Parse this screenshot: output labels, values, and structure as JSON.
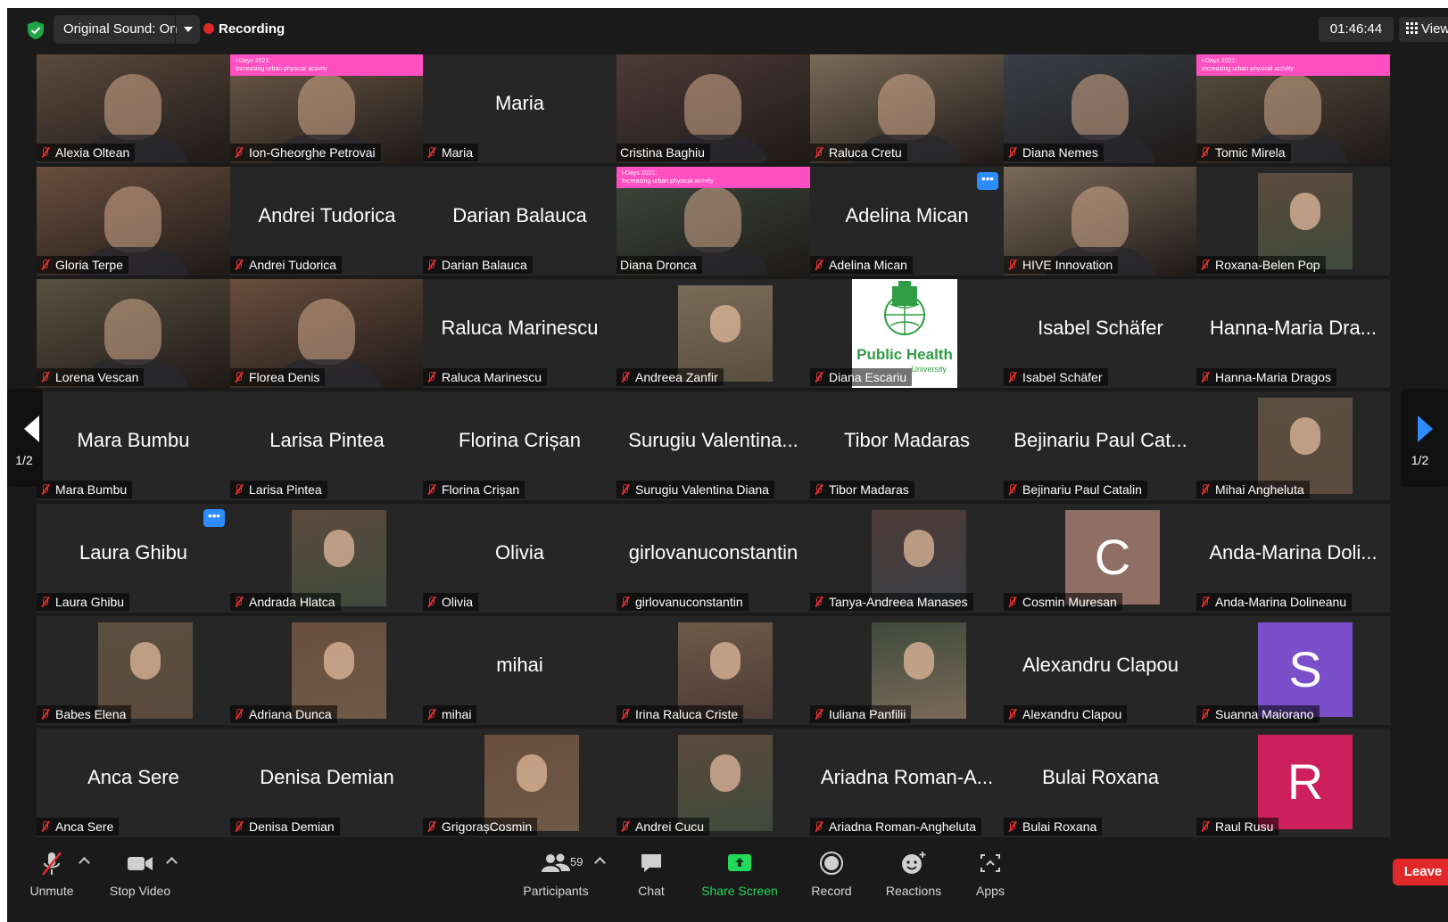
{
  "topbar": {
    "original_sound": "Original Sound: On",
    "recording": "Recording",
    "timer": "01:46:44",
    "view": "View"
  },
  "banner_text": [
    "i-Days 2021:",
    "Increasing urban physical activity"
  ],
  "pagination": {
    "left": "1/2",
    "right": "1/2"
  },
  "tiles": [
    {
      "name": "Alexia Oltean",
      "kind": "video"
    },
    {
      "name": "Ion-Gheorghe Petrovai",
      "kind": "video-banner"
    },
    {
      "name": "Maria",
      "display": "Maria",
      "kind": "name"
    },
    {
      "name": "Cristina Baghiu",
      "kind": "video",
      "active": true,
      "muted": false
    },
    {
      "name": "Raluca Cretu",
      "kind": "video"
    },
    {
      "name": "Diana Nemes",
      "kind": "video"
    },
    {
      "name": "Tomic Mirela",
      "kind": "video-banner"
    },
    {
      "name": "Gloria Terpe",
      "kind": "video"
    },
    {
      "name": "Andrei Tudorica",
      "display": "Andrei Tudorica",
      "kind": "name"
    },
    {
      "name": "Darian Balauca",
      "display": "Darian Balauca",
      "kind": "name"
    },
    {
      "name": "Diana Dronca",
      "kind": "video-banner",
      "muted": false
    },
    {
      "name": "Adelina Mican",
      "display": "Adelina Mican",
      "kind": "name",
      "more": true
    },
    {
      "name": "HIVE Innovation",
      "kind": "video"
    },
    {
      "name": "Roxana-Belen Pop",
      "kind": "photo"
    },
    {
      "name": "Lorena Vescan",
      "kind": "video"
    },
    {
      "name": "Florea Denis",
      "kind": "video"
    },
    {
      "name": "Raluca Marinescu",
      "display": "Raluca Marinescu",
      "kind": "name"
    },
    {
      "name": "Andreea Zanfir",
      "kind": "photo"
    },
    {
      "name": "Diana Escariu",
      "kind": "logo",
      "logo_text": "Public Health",
      "logo_sub": "University"
    },
    {
      "name": "Isabel Schäfer",
      "display": "Isabel Schäfer",
      "kind": "name"
    },
    {
      "name": "Hanna-Maria Dragos",
      "display": "Hanna-Maria Dra...",
      "kind": "name"
    },
    {
      "name": "Mara Bumbu",
      "display": "Mara Bumbu",
      "kind": "name"
    },
    {
      "name": "Larisa Pintea",
      "display": "Larisa Pintea",
      "kind": "name"
    },
    {
      "name": "Florina Crișan",
      "display": "Florina Crișan",
      "kind": "name"
    },
    {
      "name": "Surugiu Valentina Diana",
      "display": "Surugiu Valentina...",
      "kind": "name"
    },
    {
      "name": "Tibor Madaras",
      "display": "Tibor Madaras",
      "kind": "name"
    },
    {
      "name": "Bejinariu Paul Catalin",
      "display": "Bejinariu Paul Cat...",
      "kind": "name"
    },
    {
      "name": "Mihai Angheluta",
      "kind": "photo"
    },
    {
      "name": "Laura Ghibu",
      "display": "Laura Ghibu",
      "kind": "name",
      "more": true
    },
    {
      "name": "Andrada Hlatca",
      "kind": "photo"
    },
    {
      "name": "Olivia",
      "display": "Olivia",
      "kind": "name"
    },
    {
      "name": "girlovanuconstantin",
      "display": "girlovanuconstantin",
      "kind": "name"
    },
    {
      "name": "Tanya-Andreea Manases",
      "kind": "photo"
    },
    {
      "name": "Cosmin Muresan",
      "kind": "avatar",
      "letter": "C",
      "color": "#8f6e63"
    },
    {
      "name": "Anda-Marina Dolineanu",
      "display": "Anda-Marina Doli...",
      "kind": "name"
    },
    {
      "name": "Babes Elena",
      "kind": "photo"
    },
    {
      "name": "Adriana Dunca",
      "kind": "photo"
    },
    {
      "name": "mihai",
      "display": "mihai",
      "kind": "name"
    },
    {
      "name": "Irina Raluca Criste",
      "kind": "photo"
    },
    {
      "name": "Iuliana Panfilii",
      "kind": "photo"
    },
    {
      "name": "Alexandru Clapou",
      "display": "Alexandru Clapou",
      "kind": "name"
    },
    {
      "name": "Suanna Maiorano",
      "kind": "avatar",
      "letter": "S",
      "color": "#7b4fc9"
    },
    {
      "name": "Anca Sere",
      "display": "Anca Sere",
      "kind": "name"
    },
    {
      "name": "Denisa Demian",
      "display": "Denisa Demian",
      "kind": "name"
    },
    {
      "name": "GrigorașCosmin",
      "kind": "photo"
    },
    {
      "name": "Andrei Cucu",
      "kind": "photo"
    },
    {
      "name": "Ariadna Roman-Angheluta",
      "display": "Ariadna Roman-A...",
      "kind": "name"
    },
    {
      "name": "Bulai Roxana",
      "display": "Bulai Roxana",
      "kind": "name"
    },
    {
      "name": "Raul Rusu",
      "kind": "avatar",
      "letter": "R",
      "color": "#cc1f5c"
    }
  ],
  "toolbar": {
    "unmute": "Unmute",
    "stop_video": "Stop Video",
    "participants": "Participants",
    "participants_count": "59",
    "chat": "Chat",
    "share_screen": "Share Screen",
    "record": "Record",
    "reactions": "Reactions",
    "apps": "Apps",
    "leave": "Leave"
  },
  "colors": {
    "share_green": "#23d959",
    "leave_red": "#e02828",
    "active_speaker": "#d6e36b",
    "more_blue": "#2d8cff"
  }
}
